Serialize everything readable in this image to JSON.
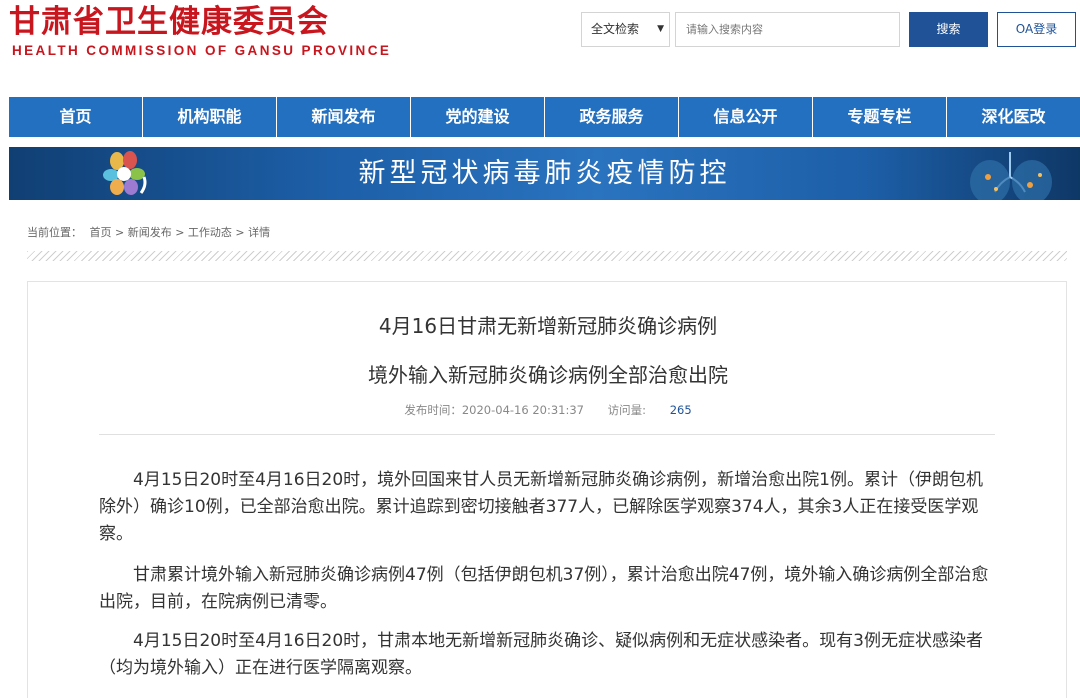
{
  "header": {
    "logo_cn": "甘肃省卫生健康委员会",
    "logo_en": "HEALTH COMMISSION OF GANSU PROVINCE",
    "search_scope": "全文检索",
    "search_placeholder": "请输入搜索内容",
    "search_button": "搜索",
    "oa_button": "OA登录"
  },
  "nav": {
    "items": [
      "首页",
      "机构职能",
      "新闻发布",
      "党的建设",
      "政务服务",
      "信息公开",
      "专题专栏",
      "深化医改"
    ]
  },
  "banner": {
    "text": "新型冠状病毒肺炎疫情防控"
  },
  "breadcrumb": {
    "label": "当前位置：",
    "path": "首页 > 新闻发布 > 工作动态 > 详情"
  },
  "article": {
    "title1": "4月16日甘肃无新增新冠肺炎确诊病例",
    "title2": "境外输入新冠肺炎确诊病例全部治愈出院",
    "publish_label": "发布时间：2020-04-16 20:31:37",
    "views_label": "访问量:",
    "views": "265",
    "paragraphs": [
      "4月15日20时至4月16日20时，境外回国来甘人员无新增新冠肺炎确诊病例，新增治愈出院1例。累计（伊朗包机除外）确诊10例，已全部治愈出院。累计追踪到密切接触者377人，已解除医学观察374人，其余3人正在接受医学观察。",
      "甘肃累计境外输入新冠肺炎确诊病例47例（包括伊朗包机37例），累计治愈出院47例，境外输入确诊病例全部治愈出院，目前，在院病例已清零。",
      "4月15日20时至4月16日20时，甘肃本地无新增新冠肺炎确诊、疑似病例和无症状感染者。现有3例无症状感染者（均为境外输入）正在进行医学隔离观察。"
    ]
  },
  "colors": {
    "brand_red": "#c8161e",
    "nav_blue": "#2470c0",
    "button_blue": "#1f5297"
  }
}
